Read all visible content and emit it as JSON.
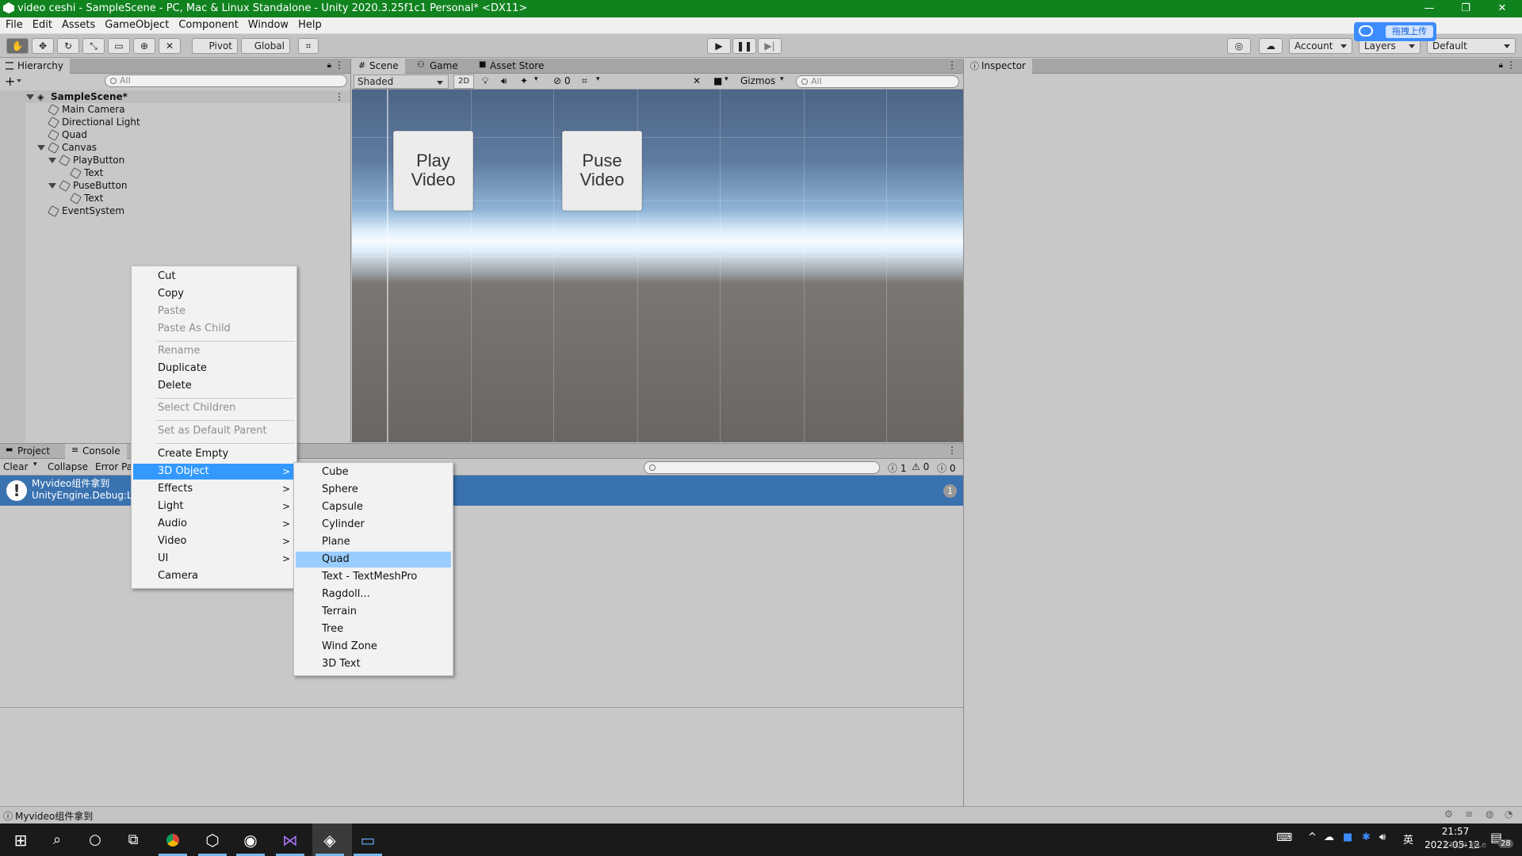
{
  "window": {
    "title": "video ceshi - SampleScene - PC, Mac & Linux Standalone - Unity 2020.3.25f1c1 Personal* <DX11>",
    "minimize": "—",
    "restore": "❐",
    "close": "✕"
  },
  "menubar": [
    "File",
    "Edit",
    "Assets",
    "GameObject",
    "Component",
    "Window",
    "Help"
  ],
  "upload_widget": {
    "label": "拖拽上传"
  },
  "toolbar": {
    "pivot": "Pivot",
    "global": "Global",
    "account": "Account",
    "layers": "Layers",
    "layout": "Default"
  },
  "hierarchy": {
    "tab": "Hierarchy",
    "search_placeholder": "All",
    "add": "+",
    "scene": "SampleScene*",
    "items": [
      {
        "label": "Main Camera",
        "depth": 1
      },
      {
        "label": "Directional Light",
        "depth": 1
      },
      {
        "label": "Quad",
        "depth": 1
      },
      {
        "label": "Canvas",
        "depth": 1,
        "expanded": true
      },
      {
        "label": "PlayButton",
        "depth": 2,
        "expanded": true
      },
      {
        "label": "Text",
        "depth": 3
      },
      {
        "label": "PuseButton",
        "depth": 2,
        "expanded": true
      },
      {
        "label": "Text",
        "depth": 3
      },
      {
        "label": "EventSystem",
        "depth": 1
      }
    ]
  },
  "scene_tabs": {
    "scene": "Scene",
    "game": "Game",
    "asset_store": "Asset Store",
    "shading": "Shaded",
    "mode_2d": "2D",
    "hidden_count": "0",
    "gizmos": "Gizmos",
    "search_placeholder": "All"
  },
  "scene_buttons": [
    {
      "line1": "Play",
      "line2": "Video"
    },
    {
      "line1": "Puse",
      "line2": "Video"
    }
  ],
  "inspector": {
    "tab": "Inspector"
  },
  "bottom_tabs": {
    "project": "Project",
    "console": "Console"
  },
  "console": {
    "clear": "Clear",
    "collapse": "Collapse",
    "error_pause": "Error Pa",
    "count_log": "1",
    "count_warn": "0",
    "count_error": "0",
    "entry_line1": "Myvideo组件拿到",
    "entry_line2": "UnityEngine.Debug:Lo",
    "entry_count": "1"
  },
  "context_menu": {
    "groups": [
      [
        {
          "label": "Cut",
          "enabled": true
        },
        {
          "label": "Copy",
          "enabled": true
        },
        {
          "label": "Paste",
          "enabled": false
        },
        {
          "label": "Paste As Child",
          "enabled": false
        }
      ],
      [
        {
          "label": "Rename",
          "enabled": false
        },
        {
          "label": "Duplicate",
          "enabled": true
        },
        {
          "label": "Delete",
          "enabled": true
        }
      ],
      [
        {
          "label": "Select Children",
          "enabled": false
        }
      ],
      [
        {
          "label": "Set as Default Parent",
          "enabled": false
        }
      ],
      [
        {
          "label": "Create Empty",
          "enabled": true
        },
        {
          "label": "3D Object",
          "enabled": true,
          "submenu": true,
          "open": true
        },
        {
          "label": "Effects",
          "enabled": true,
          "submenu": true
        },
        {
          "label": "Light",
          "enabled": true,
          "submenu": true
        },
        {
          "label": "Audio",
          "enabled": true,
          "submenu": true
        },
        {
          "label": "Video",
          "enabled": true,
          "submenu": true
        },
        {
          "label": "UI",
          "enabled": true,
          "submenu": true
        },
        {
          "label": "Camera",
          "enabled": true
        }
      ]
    ],
    "submenu_arrow": ">"
  },
  "submenu_3d": {
    "items": [
      "Cube",
      "Sphere",
      "Capsule",
      "Cylinder",
      "Plane",
      "Quad",
      "Text - TextMeshPro",
      "Ragdoll...",
      "Terrain",
      "Tree",
      "Wind Zone",
      "3D Text"
    ],
    "highlighted": "Quad"
  },
  "status": {
    "message": "Myvideo组件拿到"
  },
  "taskbar": {
    "ime": "英",
    "time": "21:57",
    "date": "2022-05-12",
    "notify_count": "28",
    "watermark": "CSDN @Le"
  },
  "colors": {
    "titlebar": "#10831f",
    "menu_highlight": "#3399ff",
    "console_selection": "#3a72b0",
    "scene_sky": "#5e7ba0",
    "scene_ground": "#6b6662"
  }
}
